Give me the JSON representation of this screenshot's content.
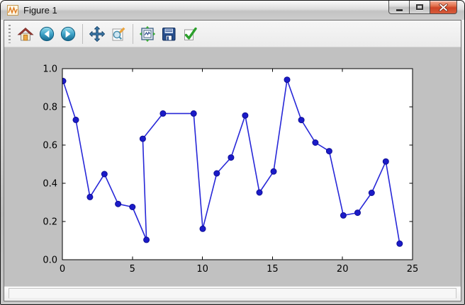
{
  "window": {
    "title": "Figure 1",
    "app_icon": "matplotlib-logo-icon",
    "controls": [
      {
        "name": "minimize",
        "icon": "minimize-icon"
      },
      {
        "name": "maximize",
        "icon": "maximize-icon"
      },
      {
        "name": "close",
        "icon": "close-icon"
      }
    ],
    "close_button_color": "#ce4526"
  },
  "toolbar": {
    "buttons": [
      {
        "name": "home",
        "icon": "home-icon"
      },
      {
        "name": "back",
        "icon": "back-arrow-icon"
      },
      {
        "name": "forward",
        "icon": "forward-arrow-icon"
      },
      {
        "name": "pan",
        "icon": "pan-arrows-icon"
      },
      {
        "name": "zoom-to-rect",
        "icon": "magnifier-pencil-icon"
      },
      {
        "name": "configure-subplots",
        "icon": "subplots-icon"
      },
      {
        "name": "save",
        "icon": "floppy-disk-icon"
      },
      {
        "name": "edit-parameters",
        "icon": "green-check-icon"
      }
    ]
  },
  "statusbar": {
    "message": ""
  },
  "chart_data": {
    "type": "line",
    "title": "",
    "xlabel": "",
    "ylabel": "",
    "x": [
      0.05,
      0.96,
      1.97,
      3.0,
      3.98,
      5.0,
      6.0,
      5.74,
      7.18,
      9.37,
      10.02,
      11.02,
      12.04,
      13.05,
      14.07,
      15.08,
      16.04,
      17.06,
      18.06,
      19.05,
      20.06,
      21.08,
      22.08,
      23.09,
      24.08
    ],
    "y": [
      0.935,
      0.732,
      0.328,
      0.448,
      0.292,
      0.276,
      0.104,
      0.633,
      0.765,
      0.765,
      0.162,
      0.452,
      0.535,
      0.755,
      0.352,
      0.462,
      0.942,
      0.731,
      0.613,
      0.568,
      0.232,
      0.246,
      0.35,
      0.514,
      0.084
    ],
    "xlim": [
      0,
      25
    ],
    "ylim": [
      0.0,
      1.0
    ],
    "xticks": [
      0,
      5,
      10,
      15,
      20,
      25
    ],
    "xtick_labels": [
      "0",
      "5",
      "10",
      "15",
      "20",
      "25"
    ],
    "yticks": [
      0.0,
      0.2,
      0.4,
      0.6,
      0.8,
      1.0
    ],
    "ytick_labels": [
      "0.0",
      "0.2",
      "0.4",
      "0.6",
      "0.8",
      "1.0"
    ],
    "grid": false,
    "legend": null,
    "marker": "o",
    "line_color": "#2727d8",
    "marker_fill": "#1b1bc8",
    "marker_edge": "#0e0e96",
    "axes_bg": "#ffffff",
    "figure_bg": "#c1c1c1"
  }
}
